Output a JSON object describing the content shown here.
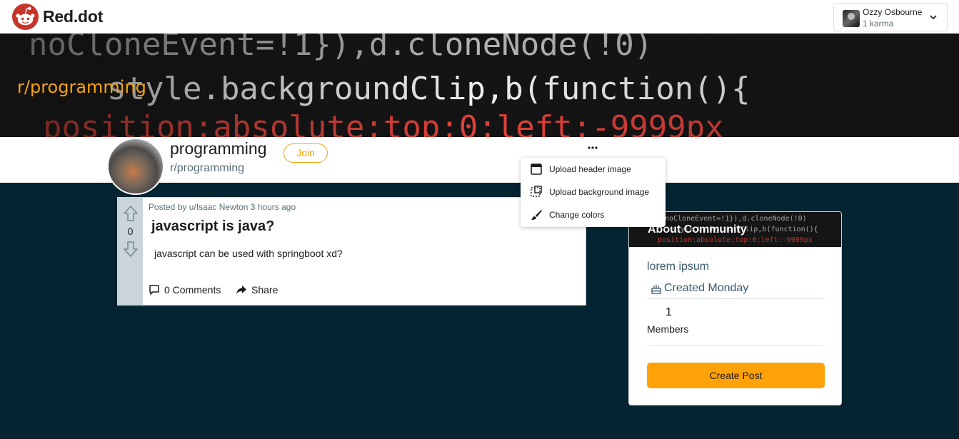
{
  "app": {
    "logo_text": "Red.dot"
  },
  "user": {
    "name": "Ozzy Osbourne",
    "karma": "1 karma"
  },
  "banner": {
    "title": "r/programming",
    "code_lines": [
      "noCloneEvent=!1}),d.cloneNode(!0)",
      "style.backgroundClip,b(function(){",
      "position:absolute;top:0;left:-9999px"
    ]
  },
  "community": {
    "name": "programming",
    "handle": "r/programming",
    "join_label": "Join"
  },
  "dropdown": {
    "items": [
      {
        "label": "Upload header image",
        "icon": "window-icon"
      },
      {
        "label": "Upload background image",
        "icon": "dashed-square-icon"
      },
      {
        "label": "Change colors",
        "icon": "paintbrush-icon"
      }
    ]
  },
  "post": {
    "meta": "Posted by u/Isaac Newton 3 hours ago",
    "title": "javascript is java?",
    "body": "javascript can be used with springboot xd?",
    "votes": "0",
    "comments_label": "0 Comments",
    "share_label": "Share"
  },
  "about": {
    "title": "About Community",
    "description": "lorem ipsum",
    "created": "Created Monday",
    "members_count": "1",
    "members_label": "Members",
    "create_post_label": "Create Post"
  },
  "colors": {
    "accent": "#ffa20a",
    "page_bg": "#042431",
    "vote_col": "#c9d4dc",
    "logo_red": "#d93a2b"
  }
}
